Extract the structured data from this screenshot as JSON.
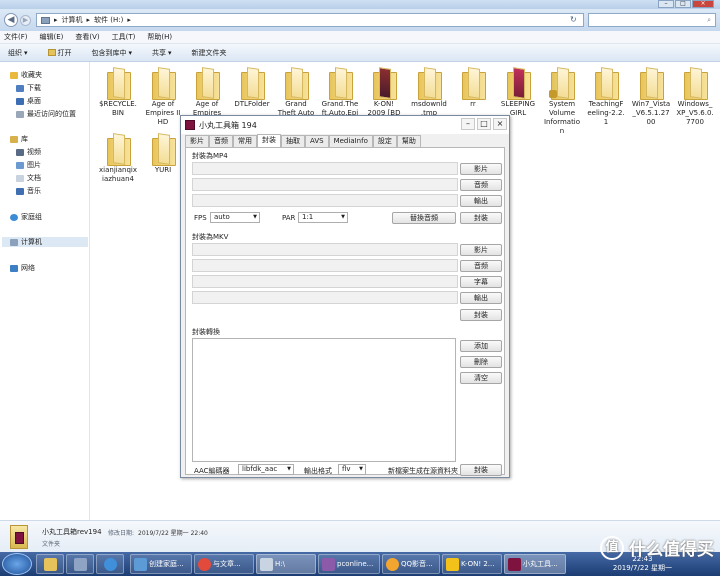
{
  "explorer": {
    "address_parts": [
      "计算机",
      "软件 (H:)"
    ],
    "search_placeholder": "",
    "menu": [
      "文件(F)",
      "编辑(E)",
      "查看(V)",
      "工具(T)",
      "帮助(H)"
    ],
    "toolbar": [
      "组织",
      "打开",
      "包含到库中",
      "共享",
      "新建文件夹"
    ],
    "nav": {
      "favorites": "收藏夹",
      "downloads": "下载",
      "desktop": "桌面",
      "recent": "最近访问的位置",
      "libraries": "库",
      "videos": "视频",
      "pictures": "图片",
      "documents": "文档",
      "music": "音乐",
      "homegroup": "家庭组",
      "computer": "计算机",
      "network": "网络"
    },
    "files": [
      {
        "name": "$RECYCLE.BIN",
        "lines": [
          "$RECYCLE.",
          "BIN"
        ]
      },
      {
        "name": "Age of Empires II HD",
        "lines": [
          "Age of",
          "Empires II",
          "HD"
        ]
      },
      {
        "name": "Age of Empires",
        "lines": [
          "Age of",
          "Empires"
        ]
      },
      {
        "name": "DTLFolder",
        "lines": [
          "DTLFolder"
        ]
      },
      {
        "name": "Grand Theft Auto",
        "lines": [
          "Grand",
          "Theft Auto"
        ]
      },
      {
        "name": "Grand.Theft.Auto.Epi",
        "lines": [
          "Grand.The",
          "ft.Auto.Epi"
        ]
      },
      {
        "name": "K-ON! 2009",
        "lines": [
          "K-ON!",
          "2009 [BD"
        ]
      },
      {
        "name": "msdownld.tmp",
        "lines": [
          "msdownld",
          ".tmp"
        ]
      },
      {
        "name": "rr",
        "lines": [
          "rr"
        ]
      },
      {
        "name": "SLEEPING GIRL",
        "lines": [
          "SLEEPING",
          "GIRL"
        ]
      },
      {
        "name": "System Volume Information",
        "lines": [
          "System",
          "Volume",
          "Informatio",
          "n"
        ]
      },
      {
        "name": "TeachingFeeling-2.2.1",
        "lines": [
          "TeachingF",
          "eeling-2.2.",
          "1"
        ]
      },
      {
        "name": "Win7_Vista_V6.5.1.2700",
        "lines": [
          "Win7_Vista",
          "_V6.5.1.27",
          "00"
        ]
      },
      {
        "name": "Windows_XP_V5.6.0.7700",
        "lines": [
          "Windows_",
          "XP_V5.6.0.",
          "7700"
        ]
      },
      {
        "name": "xianjianqixiazhuan4",
        "lines": [
          "xianjianqix",
          "iazhuan4"
        ]
      },
      {
        "name": "YURI",
        "lines": [
          "YURI"
        ]
      }
    ],
    "details": {
      "name": "小丸工具箱rev194",
      "modified_label": "修改日期:",
      "modified": "2019/7/22 星期一 22:40",
      "type": "文件夹"
    }
  },
  "app": {
    "title": "小丸工具箱 194",
    "tabs": [
      "影片",
      "音频",
      "常用",
      "封装",
      "抽取",
      "AVS",
      "MediaInfo",
      "設定",
      "幫助"
    ],
    "mp4": {
      "group": "封裝為MP4",
      "btn_video": "影片",
      "btn_audio": "音频",
      "btn_output": "輸出",
      "fps_label": "FPS",
      "fps_value": "auto",
      "par_label": "PAR",
      "par_value": "1:1",
      "btn_replace_audio": "替換音頻",
      "btn_mux": "封裝"
    },
    "mkv": {
      "group": "封裝為MKV",
      "btn_video": "影片",
      "btn_audio": "音频",
      "btn_subtitle": "字幕",
      "btn_output": "輸出",
      "btn_mux": "封裝"
    },
    "convert": {
      "group": "封裝轉換",
      "btn_add": "添加",
      "btn_delete": "刪除",
      "btn_clear": "清空",
      "aac_label": "AAC編碼器",
      "aac_value": "libfdk_aac",
      "format_label": "輸出格式",
      "format_value": "flv",
      "note": "新檔案生成在源資料夾",
      "btn_mux": "封裝"
    }
  },
  "taskbar": {
    "items": [
      "创建家庭...",
      "与文章...",
      "H:\\",
      "pconline...",
      "QQ影音...",
      "K-ON! 2...",
      "小丸工具..."
    ],
    "time": "22:43",
    "date": "2019/7/22 星期一"
  },
  "watermark": {
    "text": "什么值得买",
    "icon_char": "值"
  },
  "colors": {
    "accent": "#1c3d74",
    "app_icon": "#7e1340"
  }
}
